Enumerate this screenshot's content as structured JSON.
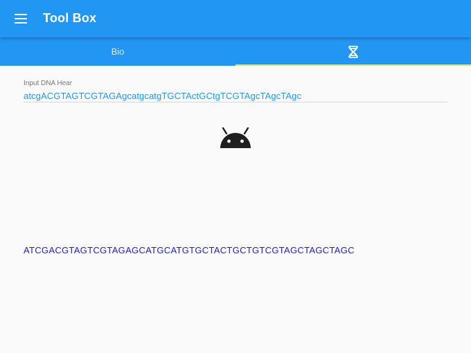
{
  "app": {
    "title": "Tool Box",
    "menu_icon": "hamburger-menu-icon"
  },
  "tabs": [
    {
      "label": "Bio",
      "selected": false
    },
    {
      "icon": "dna-icon",
      "selected": true
    }
  ],
  "input": {
    "label": "Input DNA Hear",
    "value": "atcgACGTAGTCGTAGAgcatgcatgTGCTActGCtgTCGTAgcTAgcTAgc"
  },
  "image": {
    "icon": "android-icon"
  },
  "result": {
    "text": "ATCGACGTAGTCGTAGAGCATGCATGTGCTACTGCTGTCGTAGCTAGCTAGC"
  },
  "colors": {
    "primary": "#2196f3",
    "tab_indicator": "#ffd740",
    "input_text": "#2196f3",
    "result_text": "#1a1ae0",
    "android": "#1f1f1f"
  }
}
